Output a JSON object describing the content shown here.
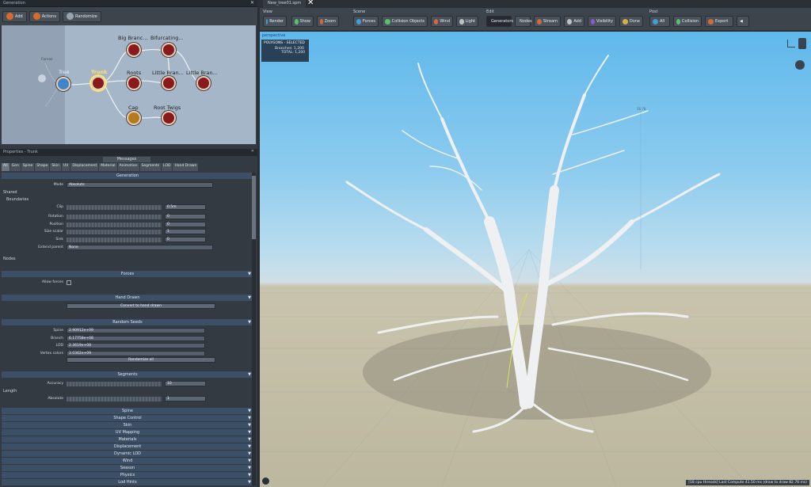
{
  "generation_panel": {
    "title": "Generation",
    "toolbar": {
      "add": "Add",
      "actions": "Actions",
      "randomize": "Randomize"
    },
    "nodes": [
      {
        "id": "forces",
        "label": "Forces"
      },
      {
        "id": "tree",
        "label": "Tree"
      },
      {
        "id": "trunk",
        "label": "Trunk"
      },
      {
        "id": "big_branches",
        "label": "Big Branc..."
      },
      {
        "id": "bifurcating",
        "label": "Bifurcating..."
      },
      {
        "id": "roots",
        "label": "Roots"
      },
      {
        "id": "little_branches_1",
        "label": "Little Bran..."
      },
      {
        "id": "little_branches_2",
        "label": "Little Bran..."
      },
      {
        "id": "cap",
        "label": "Cap"
      },
      {
        "id": "root_twigs",
        "label": "Root Twigs"
      }
    ]
  },
  "properties": {
    "title": "Properties - Trunk",
    "messages": "Messages",
    "tabs": [
      "All",
      "Gen",
      "Spine",
      "Shape",
      "Skin",
      "UV",
      "Displacement",
      "Material",
      "Animation",
      "Segments",
      "LOD",
      "Hand Drawn"
    ],
    "active_tab": "All",
    "generation": {
      "header": "Generation",
      "mode_label": "Mode",
      "mode_value": "Absolute",
      "shared_label": "Shared",
      "boundaries_label": "Boundaries",
      "clip_label": "Clip",
      "clip_value": "0.5m",
      "rows": [
        {
          "label": "Rotation",
          "value": "0"
        },
        {
          "label": "Position",
          "value": "0"
        },
        {
          "label": "Size scalar",
          "value": "1"
        },
        {
          "label": "Sink",
          "value": "0"
        }
      ],
      "extend_parent_label": "Extend parent",
      "extend_parent_value": "None"
    },
    "nodes_label": "Nodes",
    "forces": {
      "header": "Forces",
      "allow_forces": "Allow forces"
    },
    "hand_drawn": {
      "header": "Hand Drawn",
      "convert": "Convert to hand drawn"
    },
    "random_seeds": {
      "header": "Random Seeds",
      "rows": [
        {
          "label": "Spine",
          "value": "2.90912e+09"
        },
        {
          "label": "Branch",
          "value": "6.17758e+08"
        },
        {
          "label": "LOD",
          "value": "2.3619e+08"
        },
        {
          "label": "Vertex colors",
          "value": "3.0362e+09"
        }
      ],
      "randomize_all": "Randomize all"
    },
    "segments": {
      "header": "Segments",
      "accuracy_label": "Accuracy",
      "accuracy_value": "10",
      "length_label": "Length",
      "absolute_label": "Absolute",
      "absolute_value": "1"
    },
    "collapsed_sections": [
      "Spine",
      "Shape Control",
      "Skin",
      "UV Mapping",
      "Materials",
      "Displacement",
      "Dynamic LOD",
      "Wind",
      "Season",
      "Physics",
      "Lod Hints"
    ]
  },
  "viewport_tab": "New_tree01.spm",
  "right_toolbar": {
    "view": {
      "label": "View",
      "buttons": [
        "Render",
        "Show",
        "Zoom"
      ]
    },
    "scene": {
      "label": "Scene",
      "buttons": [
        "Forces",
        "Collision Objects",
        "Wind",
        "Light"
      ]
    },
    "edit": {
      "label": "Edit",
      "buttons": [
        "Generators",
        "Nodes",
        "Stream",
        "Add",
        "Visibility",
        "Done"
      ]
    },
    "post": {
      "label": "Post",
      "buttons": [
        "All",
        "Collision",
        "Export"
      ]
    }
  },
  "viewport": {
    "mode": "perspective",
    "hud_title": "POLYGONS - SELECTED",
    "hud_branches": "Branches:",
    "hud_branches_val": "1,200",
    "hud_total": "TOTAL:",
    "hud_total_val": "1,200",
    "status": "[18 cpu threads] Last Compute 41.50 ms (draw to draw 82.76 ms)",
    "height_marker": "56.78"
  },
  "colors": {
    "accent": "#3f86c9",
    "sky_top": "#5fb8ec",
    "ground": "#c3bea6"
  }
}
